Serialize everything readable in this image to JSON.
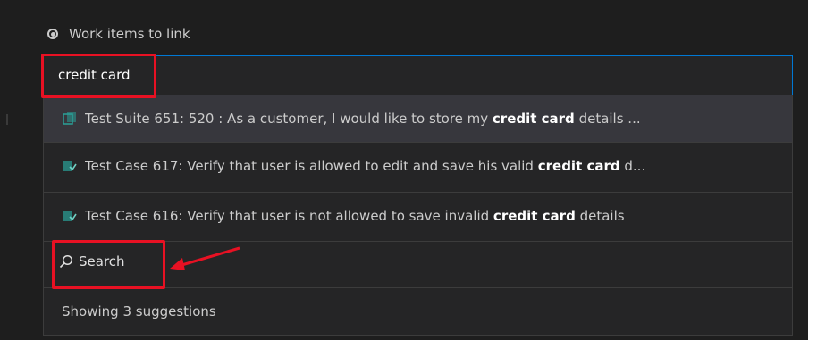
{
  "radio": {
    "label": "Work items to link",
    "selected": true
  },
  "search_input": {
    "value": "credit card"
  },
  "suggestions": [
    {
      "prefix": "Test Suite 651: 520 : As a customer, I would like to store my ",
      "match": "credit card",
      "suffix": " details ...",
      "icon": "test-suite-icon"
    },
    {
      "prefix": "Test Case 617: Verify that user is allowed to edit and save his valid ",
      "match": "credit card",
      "suffix": " d...",
      "icon": "test-case-icon"
    },
    {
      "prefix": "Test Case 616: Verify that user is not allowed to save invalid ",
      "match": "credit card",
      "suffix": " details",
      "icon": "test-case-icon"
    }
  ],
  "search_button": {
    "label": "Search",
    "icon": "search-icon"
  },
  "status_text": "Showing 3 suggestions",
  "colors": {
    "background": "#1e1e1e",
    "focus_border": "#0078d4",
    "highlight_annotation": "#e81123",
    "selected_row": "#37373d",
    "icon_teal": "#2aa198"
  }
}
